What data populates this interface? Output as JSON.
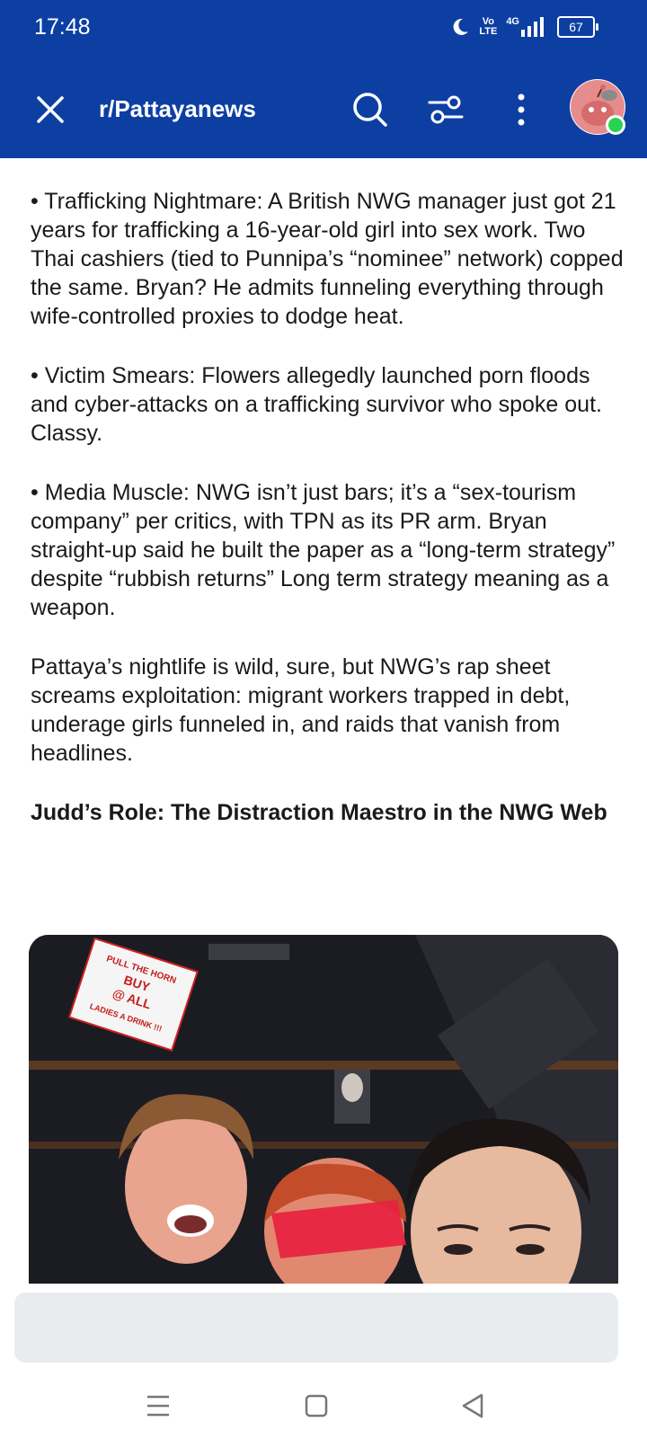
{
  "status_bar": {
    "time": "17:48",
    "network_top": "Vo",
    "network_bottom": "LTE",
    "signal_label": "4G",
    "battery": "67"
  },
  "header": {
    "subreddit": "r/Pattayanews",
    "icons": [
      "close-icon",
      "search-icon",
      "filter-icon",
      "more-icon",
      "avatar"
    ]
  },
  "post": {
    "paragraphs": [
      "• Trafficking Nightmare: A British NWG manager just got 21 years for trafficking a 16-year-old girl into sex work. Two Thai cashiers (tied to Punnipa’s “nominee” network) copped the same. Bryan? He admits funneling everything through wife-controlled proxies to dodge heat.",
      "• Victim Smears: Flowers allegedly launched porn floods and cyber-attacks on a trafficking survivor who spoke out. Classy.",
      "• Media Muscle: NWG isn’t just bars; it’s a “sex-tourism company” per critics, with TPN as its PR arm. Bryan straight-up said he built the paper as a “long-term strategy” despite “rubbish returns” Long term strategy meaning as a weapon.",
      "Pattaya’s nightlife is wild, sure, but NWG’s rap sheet screams exploitation: migrant workers trapped in debt, underage girls funneled in, and raids that vanish from headlines."
    ],
    "heading": "Judd’s Role: The Distraction Maestro in the NWG Web",
    "image_sign": [
      "PULL THE HORN",
      "BUY",
      "@ ALL",
      "LADIES A DRINK !!!"
    ]
  },
  "colors": {
    "header_bg": "#0d3fa3",
    "online": "#2bd152",
    "composer_bg": "#e9ecef"
  },
  "nav": [
    "menu-icon",
    "home-icon",
    "back-icon"
  ]
}
